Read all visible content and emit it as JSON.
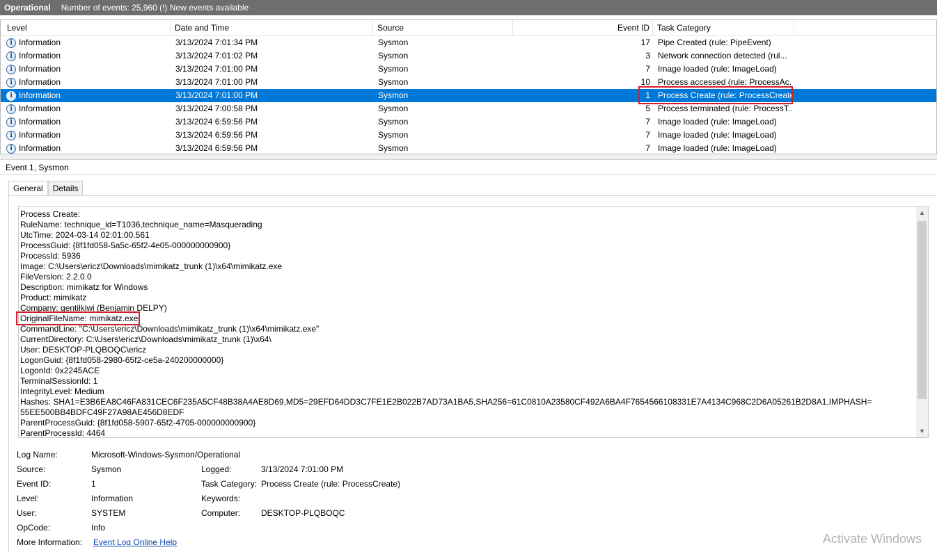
{
  "header": {
    "title": "Operational",
    "info": "Number of events: 25,960 (!) New events available"
  },
  "columns": {
    "level": "Level",
    "datetime": "Date and Time",
    "source": "Source",
    "event_id": "Event ID",
    "task_category": "Task Category"
  },
  "events": [
    {
      "level": "Information",
      "datetime": "3/13/2024 7:01:34 PM",
      "source": "Sysmon",
      "event_id": "17",
      "task": "Pipe Created (rule: PipeEvent)"
    },
    {
      "level": "Information",
      "datetime": "3/13/2024 7:01:02 PM",
      "source": "Sysmon",
      "event_id": "3",
      "task": "Network connection detected (rul..."
    },
    {
      "level": "Information",
      "datetime": "3/13/2024 7:01:00 PM",
      "source": "Sysmon",
      "event_id": "7",
      "task": "Image loaded (rule: ImageLoad)"
    },
    {
      "level": "Information",
      "datetime": "3/13/2024 7:01:00 PM",
      "source": "Sysmon",
      "event_id": "10",
      "task": "Process accessed (rule: ProcessAc..."
    },
    {
      "level": "Information",
      "datetime": "3/13/2024 7:01:00 PM",
      "source": "Sysmon",
      "event_id": "1",
      "task": "Process Create (rule: ProcessCreate)"
    },
    {
      "level": "Information",
      "datetime": "3/13/2024 7:00:58 PM",
      "source": "Sysmon",
      "event_id": "5",
      "task": "Process terminated (rule: ProcessT..."
    },
    {
      "level": "Information",
      "datetime": "3/13/2024 6:59:56 PM",
      "source": "Sysmon",
      "event_id": "7",
      "task": "Image loaded (rule: ImageLoad)"
    },
    {
      "level": "Information",
      "datetime": "3/13/2024 6:59:56 PM",
      "source": "Sysmon",
      "event_id": "7",
      "task": "Image loaded (rule: ImageLoad)"
    },
    {
      "level": "Information",
      "datetime": "3/13/2024 6:59:56 PM",
      "source": "Sysmon",
      "event_id": "7",
      "task": "Image loaded (rule: ImageLoad)"
    }
  ],
  "selected_row": 4,
  "detail": {
    "title": "Event 1, Sysmon",
    "tabs": [
      "General",
      "Details"
    ],
    "lines": [
      "Process Create:",
      "RuleName: technique_id=T1036,technique_name=Masquerading",
      "UtcTime: 2024-03-14 02:01:00.561",
      "ProcessGuid: {8f1fd058-5a5c-65f2-4e05-000000000900}",
      "ProcessId: 5936",
      "Image: C:\\Users\\ericz\\Downloads\\mimikatz_trunk (1)\\x64\\mimikatz.exe",
      "FileVersion: 2.2.0.0",
      "Description: mimikatz for Windows",
      "Product: mimikatz",
      "Company: gentilkiwi (Benjamin DELPY)",
      "OriginalFileName: mimikatz.exe",
      "CommandLine: \"C:\\Users\\ericz\\Downloads\\mimikatz_trunk (1)\\x64\\mimikatz.exe\"",
      "CurrentDirectory: C:\\Users\\ericz\\Downloads\\mimikatz_trunk (1)\\x64\\",
      "User: DESKTOP-PLQBOQC\\ericz",
      "LogonGuid: {8f1fd058-2980-65f2-ce5a-240200000000}",
      "LogonId: 0x2245ACE",
      "TerminalSessionId: 1",
      "IntegrityLevel: Medium",
      "Hashes: SHA1=E3B6EA8C46FA831CEC6F235A5CF48B38A4AE8D69,MD5=29EFD64DD3C7FE1E2B022B7AD73A1BA5,SHA256=61C0810A23580CF492A6BA4F7654566108331E7A4134C968C2D6A05261B2D8A1,IMPHASH=",
      "55EE500BB4BDFC49F27A98AE456D8EDF",
      "ParentProcessGuid: {8f1fd058-5907-65f2-4705-000000000900}",
      "ParentProcessId: 4464"
    ]
  },
  "properties": {
    "log_name_label": "Log Name:",
    "log_name": "Microsoft-Windows-Sysmon/Operational",
    "source_label": "Source:",
    "source": "Sysmon",
    "logged_label": "Logged:",
    "logged": "3/13/2024 7:01:00 PM",
    "event_id_label": "Event ID:",
    "event_id": "1",
    "task_category_label": "Task Category:",
    "task_category": "Process Create (rule: ProcessCreate)",
    "level_label": "Level:",
    "level": "Information",
    "keywords_label": "Keywords:",
    "keywords": "",
    "user_label": "User:",
    "user": "SYSTEM",
    "computer_label": "Computer:",
    "computer": "DESKTOP-PLQBOQC",
    "opcode_label": "OpCode:",
    "opcode": "Info",
    "more_info_label": "More Information:",
    "more_info_link": "Event Log Online Help"
  },
  "watermark": "Activate Windows",
  "colors": {
    "selection": "#0078d7",
    "highlight_box": "#d0202a",
    "header_bar": "#6e6e6e"
  }
}
